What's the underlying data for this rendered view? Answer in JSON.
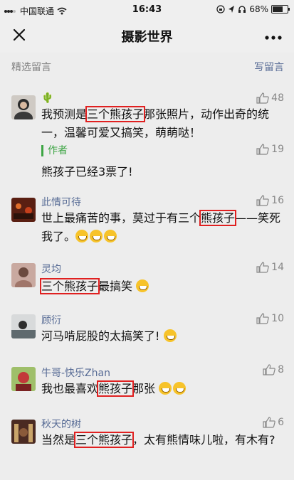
{
  "status_bar": {
    "carrier": "中国联通",
    "time": "16:43",
    "battery": "68%",
    "battery_level": 0.68
  },
  "nav": {
    "title": "摄影世界"
  },
  "section": {
    "left_label": "精选留言",
    "right_label": "写留言"
  },
  "comments": [
    {
      "name": "🌵",
      "likes": "48",
      "text_pre": "我预测是",
      "text_hl": "三个熊孩子",
      "text_post": "那张照片，动作出奇的统一，温馨可爱又搞笑，萌萌哒！",
      "author_tag": "作者",
      "author_text": "熊孩子已经3票了!",
      "author_likes": "19"
    },
    {
      "name": "此情可待",
      "likes": "16",
      "text_pre": "世上最痛苦的事，莫过于有三个",
      "text_hl": "熊孩子",
      "text_post": "——笑死我了。"
    },
    {
      "name": "灵均",
      "likes": "14",
      "text_hl": "三个熊孩子",
      "text_post": "最搞笑"
    },
    {
      "name": "顾衍",
      "likes": "10",
      "text": "河马啃屁股的太搞笑了!"
    },
    {
      "name": "牛哥-快乐Zhan",
      "likes": "8",
      "text_pre": "我也最喜欢",
      "text_hl": "熊孩子",
      "text_post": "那张"
    },
    {
      "name": "秋天的树",
      "likes": "6",
      "text_pre": "当然是",
      "text_hl": "三个熊孩子",
      "text_post": "，太有熊情味儿啦，有木有?"
    }
  ],
  "icons": {
    "close": "close-icon",
    "more": "more-icon",
    "like": "thumbs-up-icon",
    "wifi": "wifi-icon",
    "signal": "signal-icon"
  },
  "colors": {
    "link_blue": "#576b95",
    "author_green": "#3da544",
    "highlight_red": "#e02020",
    "background": "#ededed"
  }
}
